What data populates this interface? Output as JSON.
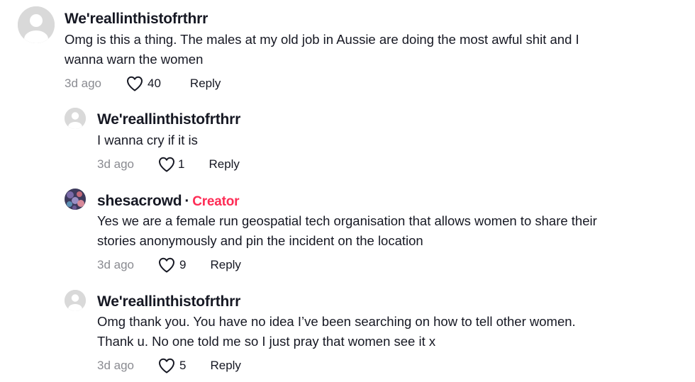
{
  "comments": [
    {
      "username": "We'reallinthistofrthrr",
      "lines": [
        "Omg is this a thing. The males at my old job in Aussie are doing the most awful shit and I",
        "wanna warn the women"
      ],
      "date": "3d ago",
      "likes": "40",
      "reply_label": "Reply",
      "avatar_icon": "default-avatar-icon"
    },
    {
      "username": "We'reallinthistofrthrr",
      "lines": [
        "I wanna cry if it is"
      ],
      "date": "3d ago",
      "likes": "1",
      "reply_label": "Reply",
      "avatar_icon": "default-avatar-icon"
    },
    {
      "username": "shesacrowd",
      "separator": "·",
      "badge": "Creator",
      "lines": [
        "Yes we are a female run geospatial tech organisation that allows women to share their",
        "stories anonymously and pin the incident on the location"
      ],
      "date": "3d ago",
      "likes": "9",
      "reply_label": "Reply",
      "avatar_icon": "profile-photo-icon"
    },
    {
      "username": "We'reallinthistofrthrr",
      "lines": [
        "Omg thank you. You have no idea I’ve been searching on how to tell other women.",
        "Thank u. No one told me so I just pray that women see it x"
      ],
      "date": "3d ago",
      "likes": "5",
      "reply_label": "Reply",
      "avatar_icon": "default-avatar-icon"
    }
  ],
  "colors": {
    "text": "#161823",
    "muted": "#8a8b91",
    "creator": "#fe2c55",
    "avatar_bg": "#d9d9d9"
  }
}
